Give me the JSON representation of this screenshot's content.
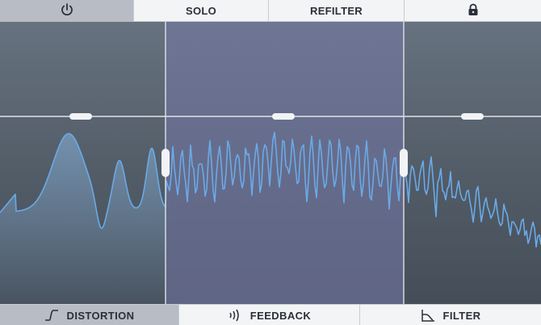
{
  "topbar": {
    "power_icon": "power-icon",
    "solo_label": "SOLO",
    "refilter_label": "REFILTER",
    "lock_icon": "lock-icon"
  },
  "bottombar": {
    "distortion_label": "DISTORTION",
    "distortion_icon": "distortion-curve-icon",
    "feedback_label": "FEEDBACK",
    "feedback_icon": "feedback-waves-icon",
    "filter_label": "FILTER",
    "filter_icon": "filter-slope-icon"
  },
  "display": {
    "bands": [
      "low",
      "mid",
      "high"
    ],
    "active_band": "mid",
    "colors": {
      "bg_top": "#66727f",
      "bg_bottom": "#454e58",
      "active_band": "#7478a8",
      "spectrum": "#6aaae8",
      "divider": "#dfe2e8"
    }
  }
}
